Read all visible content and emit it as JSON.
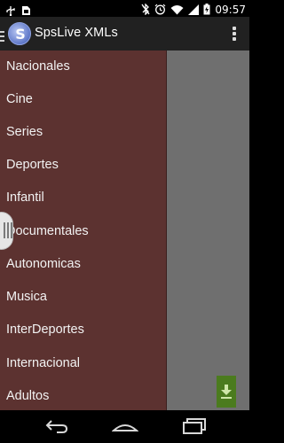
{
  "status_bar": {
    "time": "09:57",
    "left_icons": [
      "usb-icon",
      "sim-card-icon"
    ],
    "right_icons": [
      "bluetooth-off-icon",
      "alarm-icon",
      "wifi-icon",
      "signal-icon",
      "battery-charging-icon"
    ]
  },
  "action_bar": {
    "title": "SpsLive XMLs",
    "logo_letter": "S",
    "overflow_icon": "more-vert-icon"
  },
  "drawer": {
    "items": [
      {
        "label": "Nacionales"
      },
      {
        "label": "Cine"
      },
      {
        "label": "Series"
      },
      {
        "label": "Deportes"
      },
      {
        "label": "Infantil"
      },
      {
        "label": "Documentales"
      },
      {
        "label": "Autonomicas"
      },
      {
        "label": "Musica"
      },
      {
        "label": "InterDeportes"
      },
      {
        "label": "Internacional"
      },
      {
        "label": "Adultos"
      }
    ]
  },
  "content": {
    "fab_icon": "download-icon",
    "accent": "#4b7b1e",
    "drawer_color": "#5c3230"
  },
  "nav_bar": {
    "icons": [
      "back-icon",
      "home-icon",
      "recents-icon"
    ]
  }
}
